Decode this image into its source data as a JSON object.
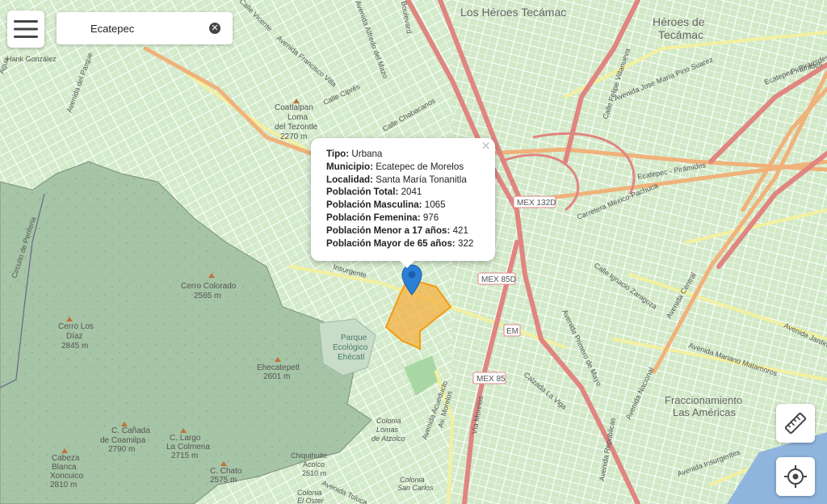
{
  "search": {
    "value": "Ecatepec"
  },
  "popup": {
    "rows": [
      {
        "label": "Tipo:",
        "value": "Urbana"
      },
      {
        "label": "Municipio:",
        "value": "Ecatepec de Morelos"
      },
      {
        "label": "Localidad:",
        "value": "Santa María Tonanitla"
      },
      {
        "label": "Población Total:",
        "value": "2041"
      },
      {
        "label": "Población Masculina:",
        "value": "1065"
      },
      {
        "label": "Población Femenina:",
        "value": "976"
      },
      {
        "label": "Población Menor a 17 años:",
        "value": "421"
      },
      {
        "label": "Población Mayor de 65 años:",
        "value": "322"
      }
    ],
    "close": "×"
  },
  "map_labels": {
    "los_heroes_tecamac": "Los Héroes Tecámac",
    "heroes_de_tecamac_1": "Héroes de",
    "heroes_de_tecamac_2": "Tecámac",
    "hank_gonzalez": "Hank González",
    "avenida_francisco_villa": "Avenida Francisco Villa",
    "coatlalpan_1": "Coatlalpan",
    "coatlalpan_2": "Loma",
    "coatlalpan_3": "del Tezontle",
    "coatlalpan_4": "2270 m",
    "calle_cipres": "Calle Ciprés",
    "calle_chabacanos": "Calle Chabacanos",
    "avenida_villanueva": "Avenida Jose María Pino Suarez",
    "ecatepec_piramides_1": "Ecatepec - Pirámides",
    "ecatepec_piramides_2": "Ecatepec - Pirámides",
    "mex132d": "MEX 132D",
    "mex85d": "MEX 85D",
    "mex85": "MEX 85",
    "em": "EM",
    "carretera_mexico_pachuca": "Carretera México-Pachuca",
    "cerro_colorado_1": "Cerro Colorado",
    "cerro_colorado_2": "2565 m",
    "cerro_los_diaz_1": "Cerro Los",
    "cerro_los_diaz_2": "Díaz",
    "cerro_los_diaz_3": "2845 m",
    "parque_ecologico_1": "Parque",
    "parque_ecologico_2": "Ecológico",
    "parque_ecologico_3": "Ehécatl",
    "ehecatepetl_1": "Ehecatepetl",
    "ehecatepetl_2": "2601 m",
    "c_canada_1": "C. Cañada",
    "c_canada_2": "de Coamilpa",
    "c_canada_3": "2790 m",
    "c_largo_1": "C. Largo",
    "c_largo_2": "La Colmena",
    "c_largo_3": "2715 m",
    "cabeza_blanca_1": "Cabeza",
    "cabeza_blanca_2": "Blanca",
    "cabeza_blanca_3": "Xoncuico",
    "cabeza_blanca_4": "2810 m",
    "c_chato_1": "C. Chato",
    "c_chato_2": "2575 m",
    "chiquihuite_1": "Chiquihuite",
    "chiquihuite_2": "Acolco",
    "chiquihuite_3": "2510 m",
    "colonia_lomas_1": "Colonia",
    "colonia_lomas_2": "Lomas",
    "colonia_lomas_3": "de Atzolco",
    "colonia_san_carlos_1": "Colonia",
    "colonia_san_carlos_2": "San Carlos",
    "colonia_el_oster_1": "Colonia",
    "colonia_el_oster_2": "El Oster",
    "avenida_toluca": "Avenida Toluca",
    "avenida_insurgentes": "Avenida Insurgentes",
    "avenida_insurgentes_top": "Insurgente",
    "via_morelos": "Vía Morelos",
    "fraccionamiento_1": "Fraccionamiento",
    "fraccionamiento_2": "Las Américas",
    "avenida_mariano_matamoros": "Avenida Mariano Matamoros",
    "avenida_primero_mayo": "Avenida Primero de Mayo",
    "avenida_central": "Avenida Central",
    "boulevard": "Boulevard",
    "calle_ignacio_zaragoza": "Calle Ignacio Zaragoza",
    "calle_la_viga": "Calzada La Viga",
    "avenida_alfredo": "Avenida Alfredo del Mazo",
    "circuito_de_periferia": "Circuito de Periferia",
    "avenida_del_parque": "Avenida del Parque",
    "avenida_acueducto": "Avenida Acueducto",
    "avenida_morelos": "Av. Morelos",
    "avenida_jardines": "Avenida Jardines",
    "avenida_agua": "Agua",
    "calle_felipe": "Calle Felipe Villanueva",
    "calle_vicente": "Calle Vicente",
    "avenida_nacional": "Avenida Nacional",
    "avenida_republicas": "Avenida Repúblicas",
    "avenida_piramides": "Pirámides"
  },
  "colors": {
    "map_bg": "#cfe8c4",
    "reserve": "#98b89a",
    "highway": "#e08580",
    "trunk": "#f0b27a",
    "secondary": "#f3f0a0",
    "polygon": "#f5b041",
    "marker": "#2b7fd6"
  },
  "icons": {
    "menu": "hamburger-menu-icon",
    "clear": "clear-search-icon",
    "marker": "map-marker-icon",
    "ruler": "ruler-icon",
    "locate": "crosshair-locate-icon"
  }
}
